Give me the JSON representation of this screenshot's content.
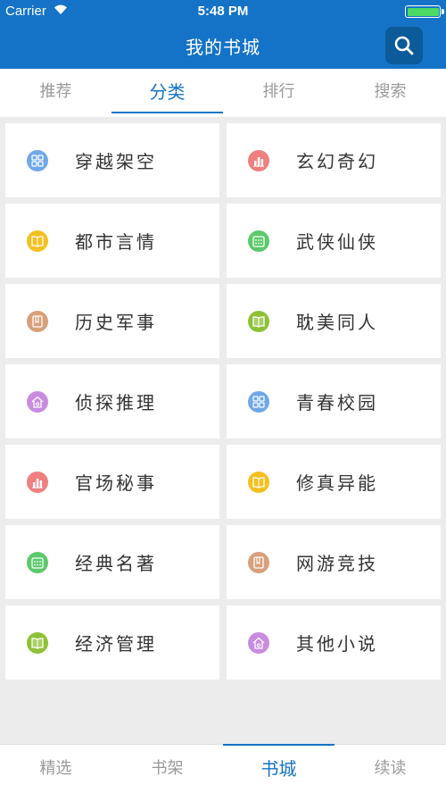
{
  "status": {
    "carrier": "Carrier",
    "time": "5:48 PM"
  },
  "header": {
    "title": "我的书城"
  },
  "tabs": [
    {
      "label": "推荐",
      "active": false
    },
    {
      "label": "分类",
      "active": true
    },
    {
      "label": "排行",
      "active": false
    },
    {
      "label": "搜索",
      "active": false
    }
  ],
  "categories": [
    {
      "label": "穿越架空",
      "icon": "grid-icon",
      "color": "#6fa8e8"
    },
    {
      "label": "玄幻奇幻",
      "icon": "bar-chart-icon",
      "color": "#f07f7f"
    },
    {
      "label": "都市言情",
      "icon": "open-book-icon",
      "color": "#f4c020"
    },
    {
      "label": "武侠仙侠",
      "icon": "calendar-icon",
      "color": "#5cc96a"
    },
    {
      "label": "历史军事",
      "icon": "scroll-icon",
      "color": "#d8a07a"
    },
    {
      "label": "耽美同人",
      "icon": "book-icon",
      "color": "#8fc136"
    },
    {
      "label": "侦探推理",
      "icon": "home-icon",
      "color": "#c98be0"
    },
    {
      "label": "青春校园",
      "icon": "grid-icon",
      "color": "#6fa8e8"
    },
    {
      "label": "官场秘事",
      "icon": "bar-chart-icon",
      "color": "#f07f7f"
    },
    {
      "label": "修真异能",
      "icon": "open-book-icon",
      "color": "#f4c020"
    },
    {
      "label": "经典名著",
      "icon": "calendar-icon",
      "color": "#5cc96a"
    },
    {
      "label": "网游竞技",
      "icon": "scroll-icon",
      "color": "#d8a07a"
    },
    {
      "label": "经济管理",
      "icon": "book-icon",
      "color": "#8fc136"
    },
    {
      "label": "其他小说",
      "icon": "home-icon",
      "color": "#c98be0"
    }
  ],
  "bottom_tabs": [
    {
      "label": "精选",
      "active": false
    },
    {
      "label": "书架",
      "active": false
    },
    {
      "label": "书城",
      "active": true
    },
    {
      "label": "续读",
      "active": false
    }
  ],
  "colors": {
    "primary": "#1473c6",
    "inactive": "#9a9a9a"
  }
}
